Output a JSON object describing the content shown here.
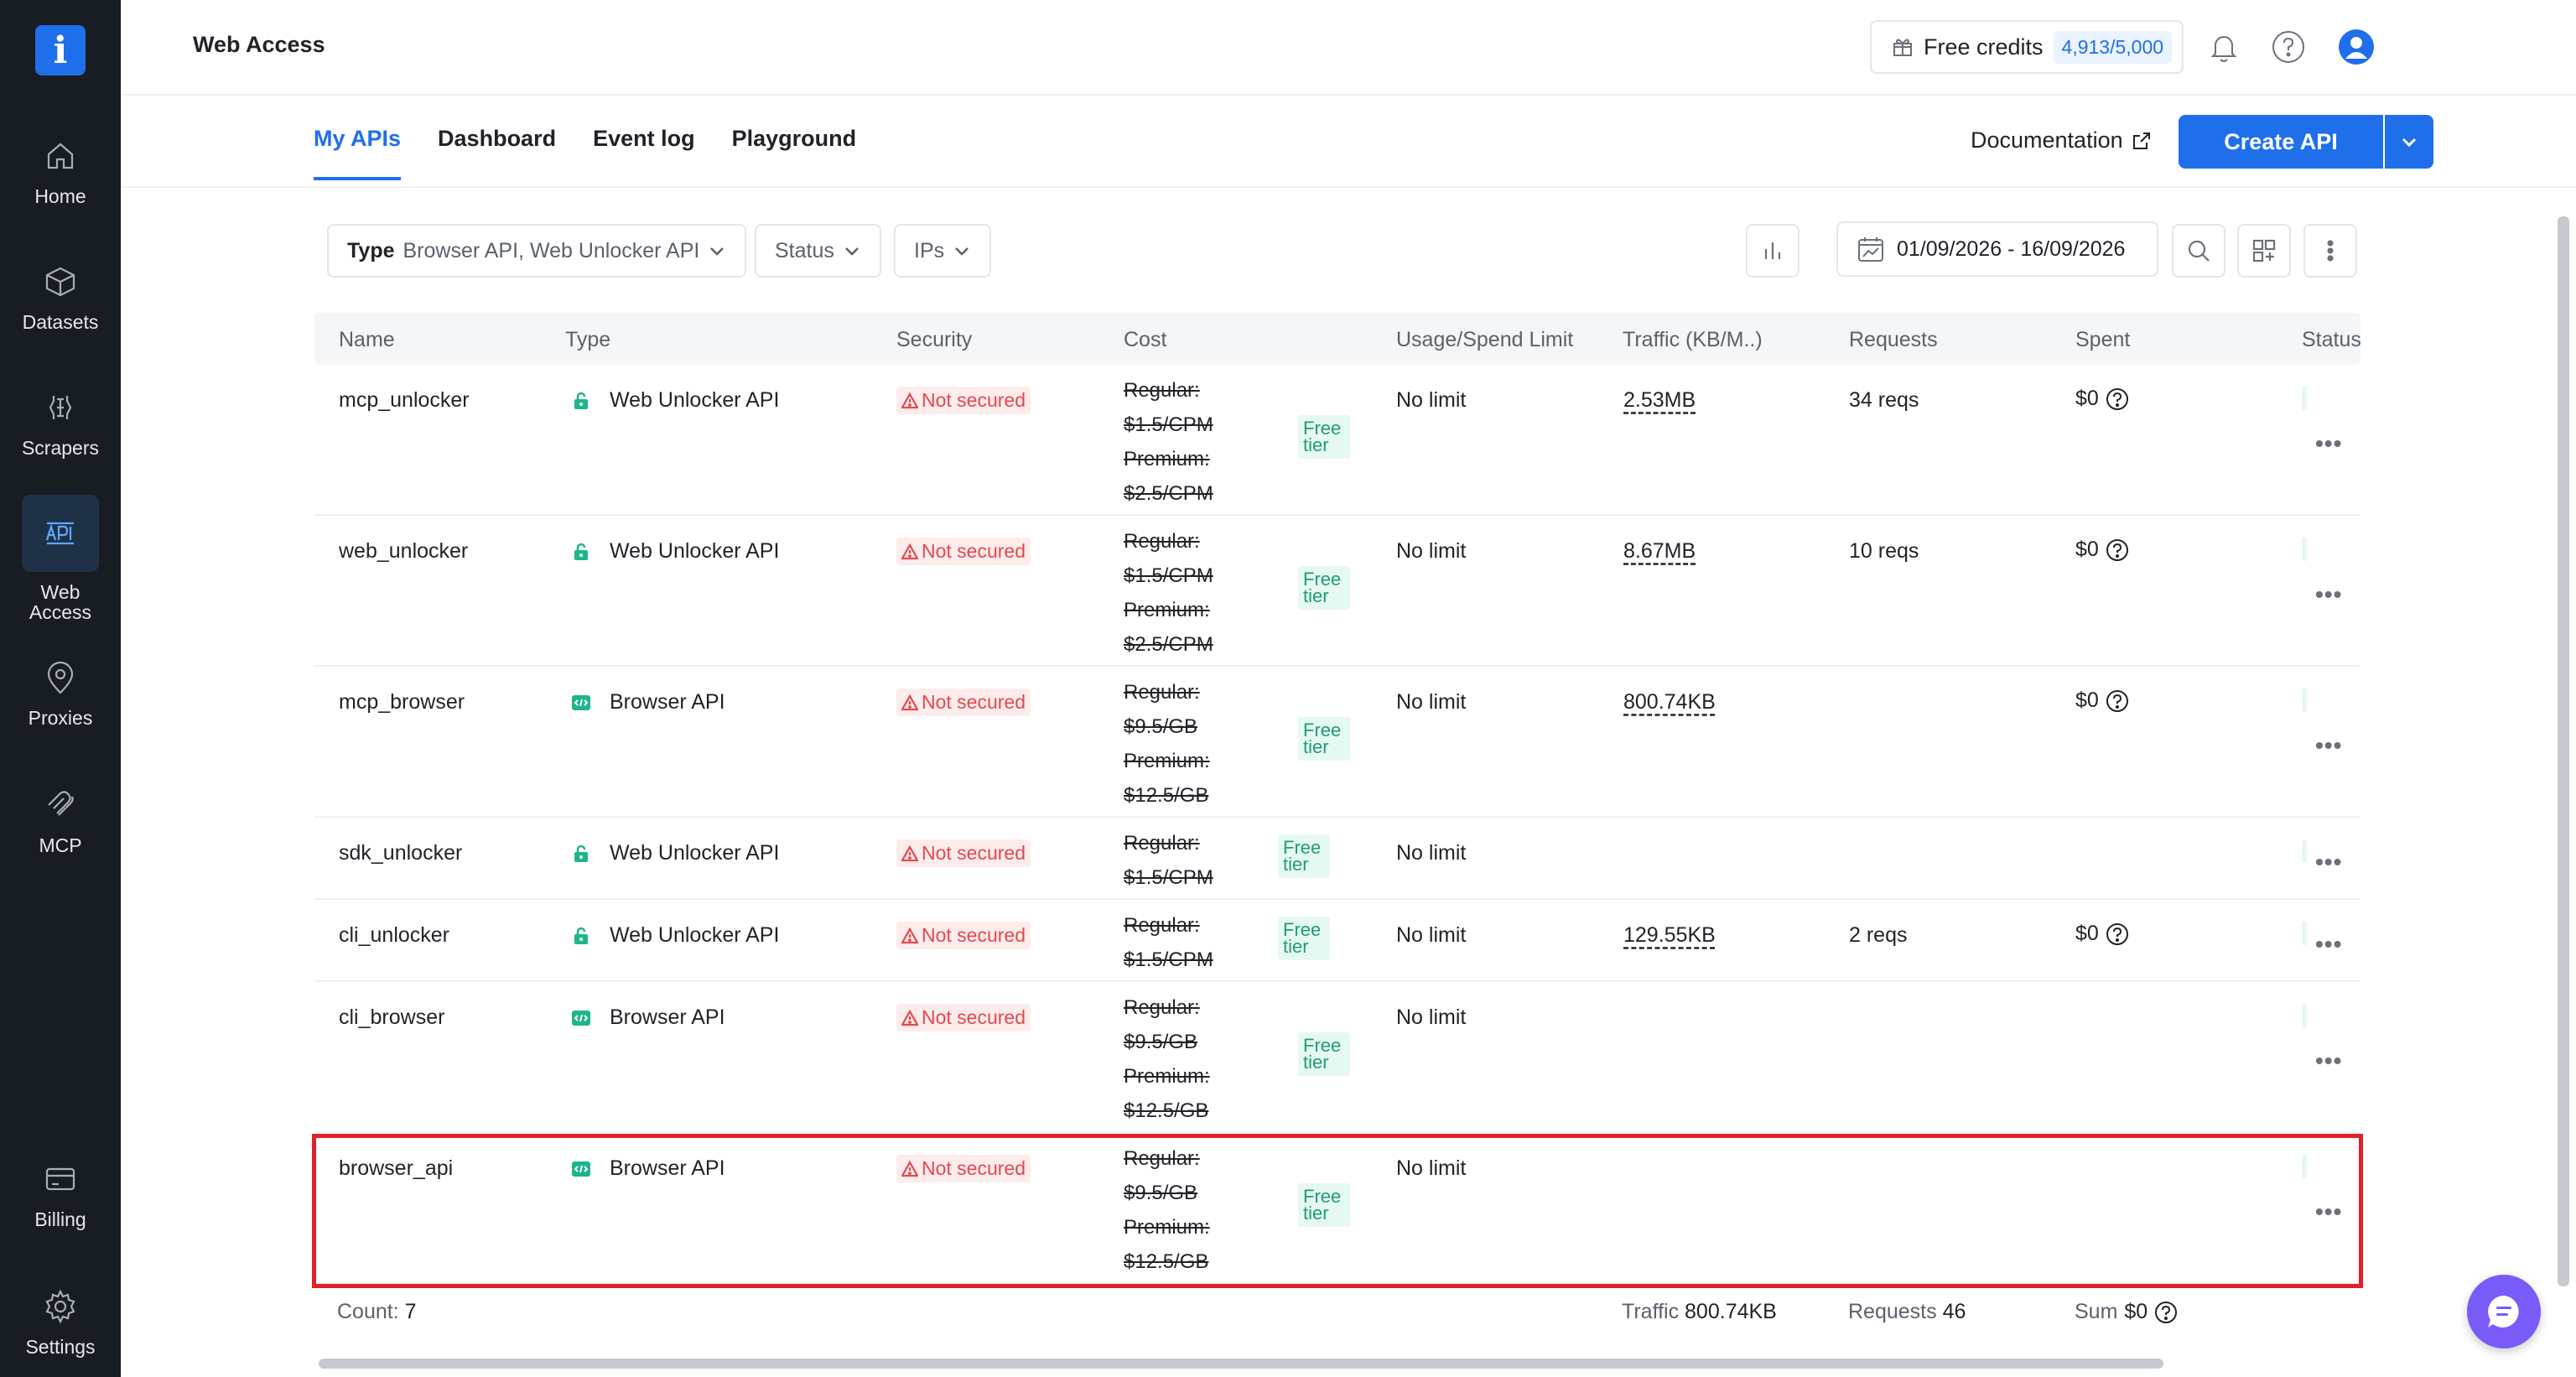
{
  "sidebar": {
    "logo": "i",
    "items": [
      {
        "label": "Home",
        "icon": "home-icon"
      },
      {
        "label": "Datasets",
        "icon": "layers-icon"
      },
      {
        "label": "Scrapers",
        "icon": "scraper-icon"
      },
      {
        "label": "Web Access",
        "icon": "api-icon"
      },
      {
        "label": "Proxies",
        "icon": "location-pin-icon"
      },
      {
        "label": "MCP",
        "icon": "mcp-icon"
      },
      {
        "label": "Billing",
        "icon": "billing-icon"
      },
      {
        "label": "Settings",
        "icon": "gear-icon"
      }
    ]
  },
  "header": {
    "title": "Web Access",
    "credits_label": "Free credits",
    "credits_value": "4,913/5,000"
  },
  "tabs": [
    "My APIs",
    "Dashboard",
    "Event log",
    "Playground"
  ],
  "actions": {
    "documentation": "Documentation",
    "create_api": "Create API"
  },
  "filters": {
    "type_label": "Type",
    "type_value": "Browser API, Web Unlocker API",
    "status": "Status",
    "ips": "IPs",
    "date_range": "01/09/2026 - 16/09/2026"
  },
  "table": {
    "headers": [
      "Name",
      "Type",
      "Security",
      "Cost",
      "Usage/Spend Limit",
      "Traffic (KB/M..)",
      "Requests",
      "Spent",
      "Status"
    ],
    "rows": [
      {
        "name": "mcp_unlocker",
        "type": "Web Unlocker API",
        "security": "Not secured",
        "cost": [
          "Regular:",
          "$1.5/CPM",
          "Premium:",
          "$2.5/CPM"
        ],
        "free": "Free tier",
        "limit": "No limit",
        "traffic": "2.53MB",
        "requests": "34 reqs",
        "spent": "$0"
      },
      {
        "name": "web_unlocker",
        "type": "Web Unlocker API",
        "security": "Not secured",
        "cost": [
          "Regular:",
          "$1.5/CPM",
          "Premium:",
          "$2.5/CPM"
        ],
        "free": "Free tier",
        "limit": "No limit",
        "traffic": "8.67MB",
        "requests": "10 reqs",
        "spent": "$0"
      },
      {
        "name": "mcp_browser",
        "type": "Browser API",
        "security": "Not secured",
        "cost": [
          "Regular:",
          "$9.5/GB",
          "Premium:",
          "$12.5/GB"
        ],
        "free": "Free tier",
        "limit": "No limit",
        "traffic": "800.74KB",
        "requests": "",
        "spent": "$0"
      },
      {
        "name": "sdk_unlocker",
        "type": "Web Unlocker API",
        "security": "Not secured",
        "cost": [
          "Regular:",
          "$1.5/CPM"
        ],
        "free": "Free tier",
        "limit": "No limit",
        "traffic": "",
        "requests": "",
        "spent": ""
      },
      {
        "name": "cli_unlocker",
        "type": "Web Unlocker API",
        "security": "Not secured",
        "cost": [
          "Regular:",
          "$1.5/CPM"
        ],
        "free": "Free tier",
        "limit": "No limit",
        "traffic": "129.55KB",
        "requests": "2 reqs",
        "spent": "$0"
      },
      {
        "name": "cli_browser",
        "type": "Browser API",
        "security": "Not secured",
        "cost": [
          "Regular:",
          "$9.5/GB",
          "Premium:",
          "$12.5/GB"
        ],
        "free": "Free tier",
        "limit": "No limit",
        "traffic": "",
        "requests": "",
        "spent": ""
      },
      {
        "name": "browser_api",
        "type": "Browser API",
        "security": "Not secured",
        "cost": [
          "Regular:",
          "$9.5/GB",
          "Premium:",
          "$12.5/GB"
        ],
        "free": "Free tier",
        "limit": "No limit",
        "traffic": "",
        "requests": "",
        "spent": ""
      }
    ],
    "footer": {
      "count_label": "Count:",
      "count": "7",
      "traffic_label": "Traffic",
      "traffic": "800.74KB",
      "requests_label": "Requests",
      "requests": "46",
      "sum_label": "Sum",
      "sum": "$0"
    }
  },
  "colors": {
    "accent": "#1f6feb",
    "danger": "#e5484d",
    "success": "#1f9d74",
    "sidebar": "#181c23"
  }
}
